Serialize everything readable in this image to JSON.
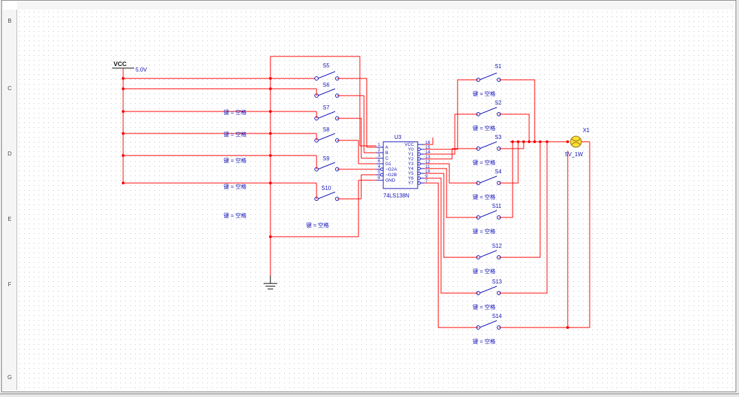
{
  "ruler_left": [
    "B",
    "C",
    "D",
    "E",
    "F",
    "G"
  ],
  "power": {
    "net": "VCC",
    "value": "5.0V"
  },
  "ic": {
    "ref": "U3",
    "part": "74LS138N",
    "pins_left": [
      "A",
      "B",
      "C",
      "G1",
      "~G2A",
      "~G2B",
      "GND"
    ],
    "pins_right": [
      "VCC",
      "Y0",
      "Y1",
      "Y2",
      "Y3",
      "Y4",
      "Y5",
      "Y6",
      "Y7"
    ],
    "pinnum_left": [
      "1",
      "2",
      "3",
      "6",
      "4",
      "5",
      "8"
    ],
    "pinnum_right": [
      "16",
      "15",
      "14",
      "13",
      "12",
      "11",
      "10",
      "9",
      "7"
    ]
  },
  "lamp": {
    "ref": "X1",
    "value": "5V_1W"
  },
  "key_label": "键 = 空格",
  "left_switches": [
    "S5",
    "S6",
    "S7",
    "S8",
    "S9",
    "S10"
  ],
  "right_switches": [
    "S1",
    "S2",
    "S3",
    "S4",
    "S11",
    "S12",
    "S13",
    "S14"
  ]
}
